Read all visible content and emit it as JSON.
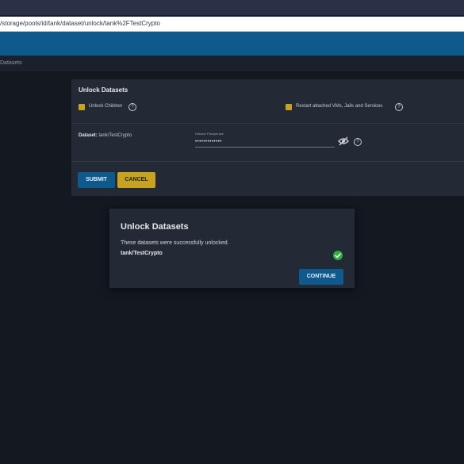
{
  "browser": {
    "url": "/storage/pools/id/tank/dataset/unlock/tank%2FTestCrypto"
  },
  "breadcrumb": {
    "label": "Datasets"
  },
  "form": {
    "title": "Unlock Datasets",
    "unlock_children_label": "Unlock Children",
    "restart_services_label": "Restart attached VMs, Jails and Services",
    "dataset_label": "Dataset:",
    "dataset_value": "tank/TestCrypto",
    "passphrase_label": "Dataset Passphrase",
    "passphrase_value": "•••••••••••••",
    "submit_label": "SUBMIT",
    "cancel_label": "CANCEL",
    "help_glyph": "?"
  },
  "dialog": {
    "title": "Unlock Datasets",
    "message": "These datasets were successfully unlocked.",
    "dataset": "tank/TestCrypto",
    "continue_label": "CONTINUE",
    "status_icon": "check-circle-icon"
  },
  "colors": {
    "accent_blue": "#0f5a8c",
    "accent_yellow": "#c7a320",
    "success_green": "#2fae3f",
    "panel": "#232a35",
    "background": "#131821"
  }
}
